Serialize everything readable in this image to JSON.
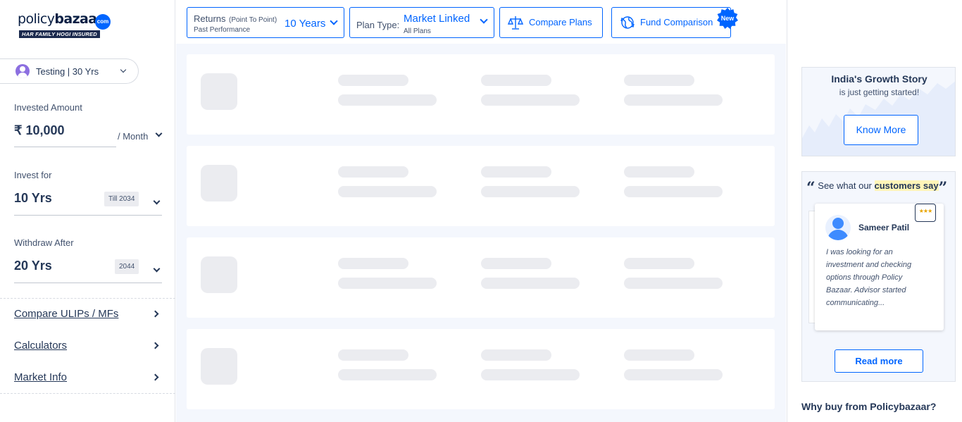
{
  "brand": {
    "name_light": "policy",
    "name_bold": "bazaar",
    "dotcom": "com",
    "tagline": "HAR FAMILY HOGI INSURED"
  },
  "sidebar": {
    "profile_label": "Testing | 30 Yrs",
    "invested_label": "Invested Amount",
    "invested_value": "₹ 10,000",
    "invested_freq": "/ Month",
    "invest_for_label": "Invest for",
    "invest_for_value": "10 Yrs",
    "invest_for_chip": "Till 2034",
    "withdraw_label": "Withdraw After",
    "withdraw_value": "20 Yrs",
    "withdraw_chip": "2044",
    "links": [
      "Compare ULIPs / MFs",
      "Calculators",
      "Market Info"
    ]
  },
  "topbar": {
    "returns_label": "Returns",
    "returns_paren": "(Point To Point)",
    "returns_sub": "Past Performance",
    "returns_value": "10 Years",
    "plan_type_label": "Plan Type:",
    "plan_type_value": "Market Linked",
    "plan_type_sub": "All Plans",
    "compare_label": "Compare Plans",
    "fund_compare_label": "Fund Comparison",
    "new_badge": "New"
  },
  "right": {
    "growth_title": "India's Growth Story",
    "growth_sub": "is just getting started!",
    "know_more": "Know More",
    "reviews_prefix": "See what our",
    "reviews_highlight": "customers say",
    "reviewer_name": "Sameer Patil",
    "review_text": "I was looking for an investment and checking options through Policy Bazaar. Advisor started communicating...",
    "read_more": "Read more",
    "why_title": "Why buy from Policybazaar?"
  },
  "icons": {
    "user": "user-icon",
    "compare": "balance-scale-icon",
    "fund": "globe-arrows-icon",
    "rating": "rating-stars-icon"
  },
  "colors": {
    "primary": "#0065ff",
    "text": "#253858",
    "skeleton": "#ebecf0",
    "panel_bg": "#f4f7fd",
    "highlight": "#fff5b8"
  }
}
